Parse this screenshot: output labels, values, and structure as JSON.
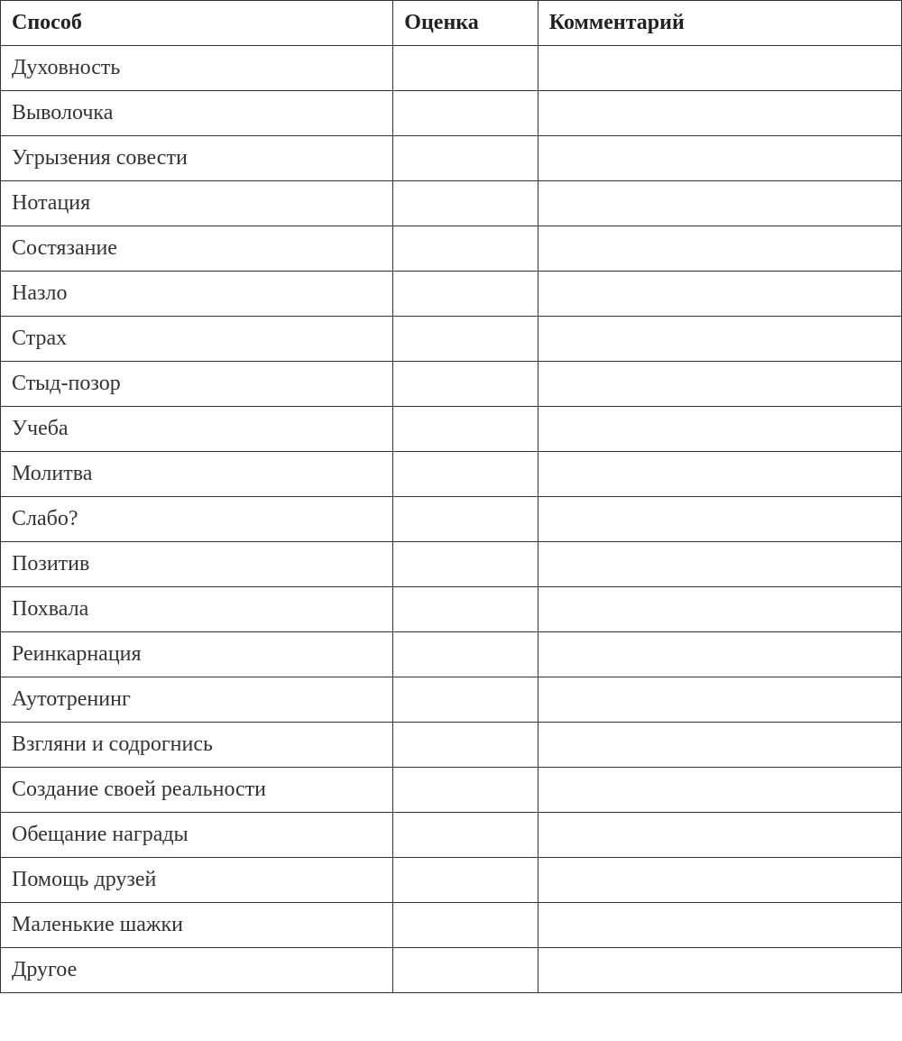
{
  "table": {
    "headers": {
      "method": "Способ",
      "rating": "Оценка",
      "comment": "Комментарий"
    },
    "rows": [
      {
        "method": "Духовность",
        "rating": "",
        "comment": ""
      },
      {
        "method": "Выволочка",
        "rating": "",
        "comment": ""
      },
      {
        "method": "Угрызения совести",
        "rating": "",
        "comment": ""
      },
      {
        "method": "Нотация",
        "rating": "",
        "comment": ""
      },
      {
        "method": "Состязание",
        "rating": "",
        "comment": ""
      },
      {
        "method": "Назло",
        "rating": "",
        "comment": ""
      },
      {
        "method": "Страх",
        "rating": "",
        "comment": ""
      },
      {
        "method": "Стыд-позор",
        "rating": "",
        "comment": ""
      },
      {
        "method": "Учеба",
        "rating": "",
        "comment": ""
      },
      {
        "method": "Молитва",
        "rating": "",
        "comment": ""
      },
      {
        "method": "Слабо?",
        "rating": "",
        "comment": ""
      },
      {
        "method": "Позитив",
        "rating": "",
        "comment": ""
      },
      {
        "method": "Похвала",
        "rating": "",
        "comment": ""
      },
      {
        "method": "Реинкарнация",
        "rating": "",
        "comment": ""
      },
      {
        "method": "Аутотренинг",
        "rating": "",
        "comment": ""
      },
      {
        "method": "Взгляни и содрогнись",
        "rating": "",
        "comment": ""
      },
      {
        "method": "Создание своей реальности",
        "rating": "",
        "comment": ""
      },
      {
        "method": "Обещание награды",
        "rating": "",
        "comment": ""
      },
      {
        "method": "Помощь друзей",
        "rating": "",
        "comment": ""
      },
      {
        "method": "Маленькие шажки",
        "rating": "",
        "comment": ""
      },
      {
        "method": "Другое",
        "rating": "",
        "comment": ""
      }
    ]
  }
}
